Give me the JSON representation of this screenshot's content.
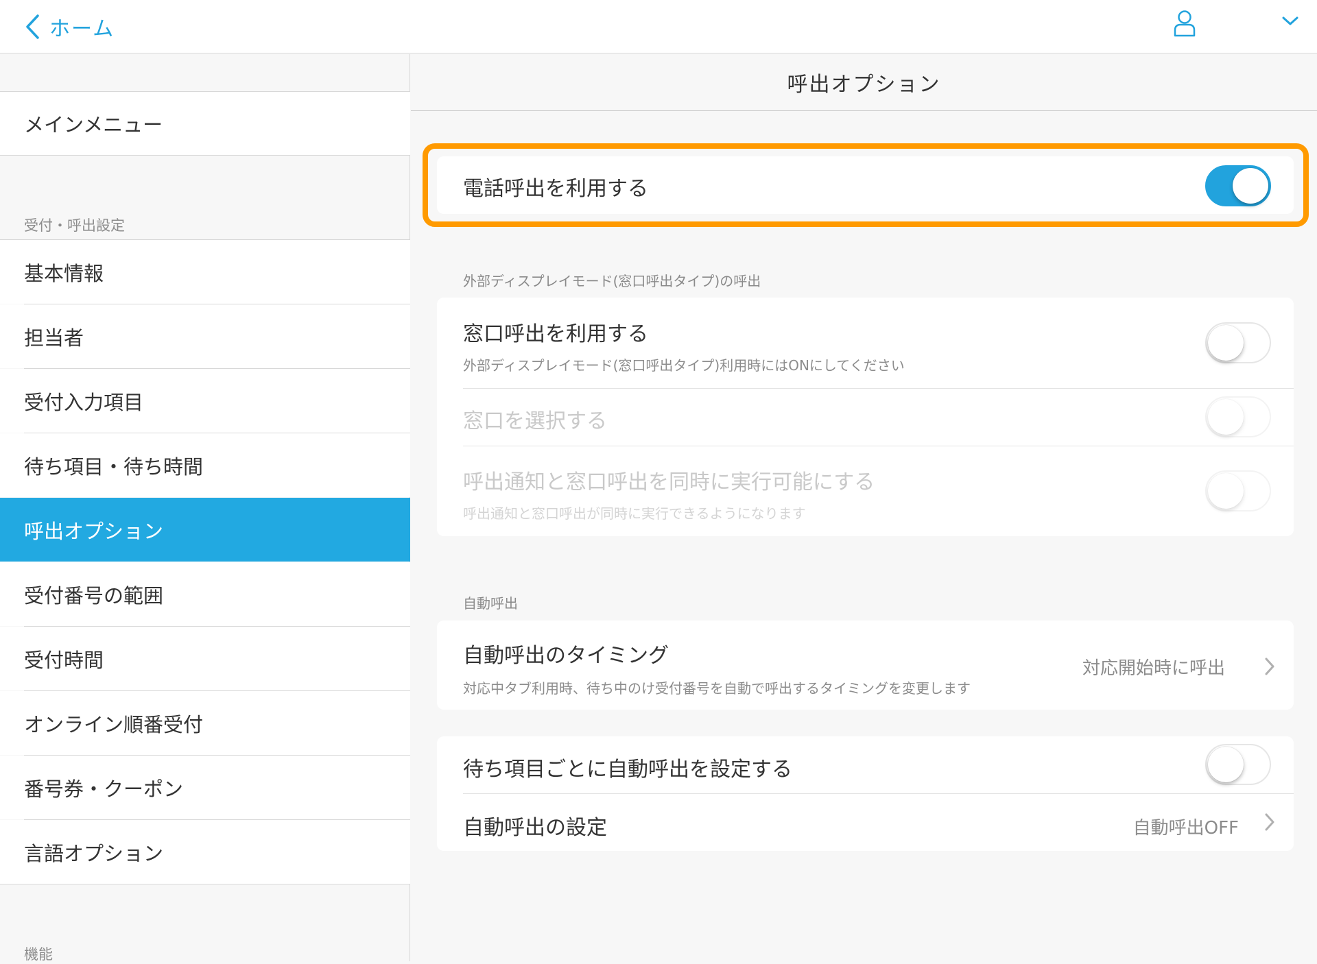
{
  "topbar": {
    "back_label": "ホーム",
    "back_icon": "chevron-left-icon",
    "user_icon": "user-icon",
    "menu_icon": "chevron-down-icon",
    "accent_color": "#22a3dd"
  },
  "sidebar": {
    "main_menu": "メインメニュー",
    "section_reception": "受付・呼出設定",
    "items": [
      {
        "label": "基本情報"
      },
      {
        "label": "担当者"
      },
      {
        "label": "受付入力項目"
      },
      {
        "label": "待ち項目・待ち時間"
      },
      {
        "label": "呼出オプション",
        "selected": true
      },
      {
        "label": "受付番号の範囲"
      },
      {
        "label": "受付時間"
      },
      {
        "label": "オンライン順番受付"
      },
      {
        "label": "番号券・クーポン"
      },
      {
        "label": "言語オプション"
      }
    ],
    "section_features": "機能",
    "selected_color": "#22a9e1"
  },
  "main": {
    "title": "呼出オプション",
    "phone_call": {
      "label": "電話呼出を利用する",
      "on": true
    },
    "external_display": {
      "section_label": "外部ディスプレイモード(窓口呼出タイプ)の呼出",
      "counter_call": {
        "label": "窓口呼出を利用する",
        "sub": "外部ディスプレイモード(窓口呼出タイプ)利用時にはONにしてください",
        "on": false
      },
      "select_counter": {
        "label": "窓口を選択する",
        "on": false,
        "disabled": true
      },
      "simultaneous": {
        "label": "呼出通知と窓口呼出を同時に実行可能にする",
        "sub": "呼出通知と窓口呼出が同時に実行できるようになります",
        "on": false,
        "disabled": true
      }
    },
    "auto_call": {
      "section_label": "自動呼出",
      "timing": {
        "label": "自動呼出のタイミング",
        "sub": "対応中タブ利用時、待ち中のけ受付番号を自動で呼出するタイミングを変更します",
        "value": "対応開始時に呼出"
      },
      "per_item": {
        "label": "待ち項目ごとに自動呼出を設定する",
        "on": false
      },
      "settings": {
        "label": "自動呼出の設定",
        "value": "自動呼出OFF"
      }
    },
    "highlight_color": "#ff9a00"
  }
}
